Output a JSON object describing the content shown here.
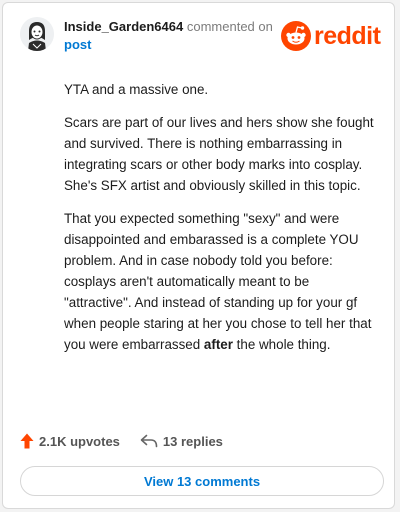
{
  "header": {
    "username": "Inside_Garden6464",
    "commented_on": "commented on",
    "post_link": "post",
    "brand": "reddit"
  },
  "comment": {
    "paragraphs": [
      {
        "text": "YTA and a massive one."
      },
      {
        "text": "Scars are part of our lives and hers show she fought and survived. There is nothing embarrassing in integrating scars or other body marks into cosplay. She's SFX artist and obviously skilled in this topic."
      },
      {
        "text_before": "That you expected something \"sexy\" and were disappointed and embarassed is a complete YOU problem. And in case nobody told you before: cosplays aren't automatically meant to be \"attractive\". And instead of standing up for your gf when people staring at her you chose to tell her that you were embarrassed ",
        "bold": "after",
        "text_after": " the whole thing."
      }
    ]
  },
  "actions": {
    "upvotes": "2.1K upvotes",
    "replies": "13 replies",
    "view_comments": "View 13 comments"
  },
  "icons": {
    "upvote": "upvote-arrow-icon",
    "reply": "reply-arrow-icon",
    "brand": "reddit-snoo-logo-icon",
    "avatar": "user-avatar-icon"
  },
  "colors": {
    "brand": "#ff4500",
    "link": "#0079d3",
    "upvote": "#ff4500",
    "text": "#1c1c1c",
    "muted": "#7c7c7c"
  }
}
